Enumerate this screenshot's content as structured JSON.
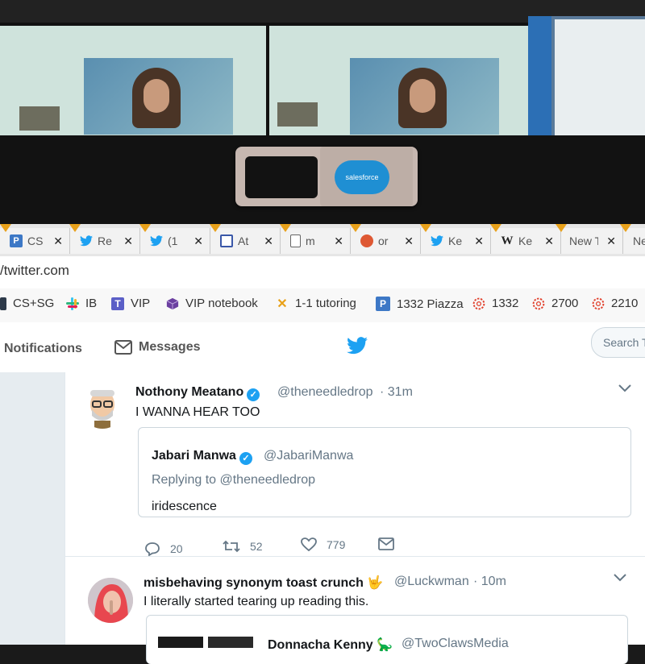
{
  "browser": {
    "tabs": [
      {
        "icon": "piazza-icon",
        "label": "CS"
      },
      {
        "icon": "twitter-icon",
        "label": "Re"
      },
      {
        "icon": "twitter-icon",
        "label": "(1"
      },
      {
        "icon": "app-icon",
        "label": "At"
      },
      {
        "icon": "document-icon",
        "label": "m"
      },
      {
        "icon": "duckduckgo-icon",
        "label": "or"
      },
      {
        "icon": "twitter-icon",
        "label": "Ke"
      },
      {
        "icon": "wikipedia-icon",
        "label": "Ke"
      },
      {
        "icon": "new-tab-icon",
        "label": "New T"
      },
      {
        "icon": "new-tab-icon",
        "label": "Ne"
      }
    ],
    "tab_close_glyph": "✕",
    "url": "/twitter.com",
    "bookmarks": [
      {
        "icon": "bookmark-folder-icon",
        "label": "CS+SG"
      },
      {
        "icon": "slack-icon",
        "label": "IB"
      },
      {
        "icon": "teams-icon",
        "label": "VIP"
      },
      {
        "icon": "cube-icon",
        "label": "VIP notebook"
      },
      {
        "icon": "tutoring-icon",
        "label": "1-1 tutoring"
      },
      {
        "icon": "piazza-icon",
        "label": "1332 Piazza"
      },
      {
        "icon": "canvas-icon",
        "label": "1332"
      },
      {
        "icon": "canvas-icon",
        "label": "2700"
      },
      {
        "icon": "canvas-icon",
        "label": "2210"
      }
    ]
  },
  "webcam_cover": {
    "brand": "salesforce"
  },
  "twitter_nav": {
    "notifications": "Notifications",
    "messages": "Messages",
    "search_placeholder": "Search T"
  },
  "tweets": [
    {
      "name": "Nothony Meatano",
      "handle": "@theneedledrop",
      "time": "· 31m",
      "text": "I WANNA HEAR TOO",
      "quoted": {
        "name": "Jabari Manwa",
        "handle": "@JabariManwa",
        "reply_to": "Replying to @theneedledrop",
        "text": "iridescence"
      },
      "replies": "20",
      "retweets": "52",
      "likes": "779"
    },
    {
      "name": "misbehaving synonym toast crunch",
      "name_emoji": "🤟",
      "handle": "@Luckwman",
      "time": "· 10m",
      "text": "I literally started tearing up reading this.",
      "quoted": {
        "name": "Donnacha Kenny",
        "name_emoji": "🦕",
        "handle": "@TwoClawsMedia"
      }
    }
  ],
  "colors": {
    "twitter_blue": "#1da1f2",
    "tab_marker": "#e8a11a",
    "text_primary": "#14171a",
    "text_secondary": "#657786"
  }
}
